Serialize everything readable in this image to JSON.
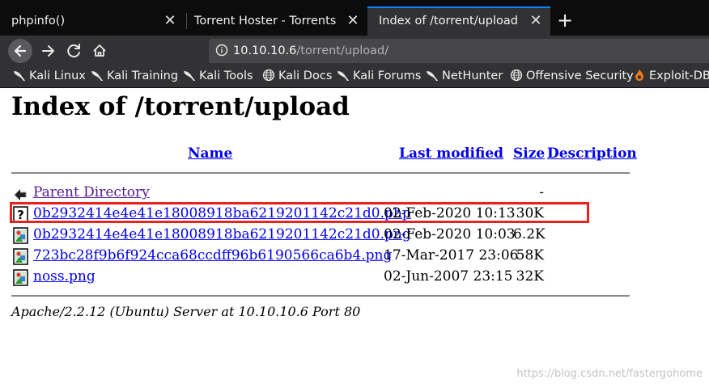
{
  "tabs": [
    {
      "title": "phpinfo()",
      "close": "✕"
    },
    {
      "title": "Torrent Hoster - Torrents",
      "close": "✕"
    },
    {
      "title": "Index of /torrent/upload",
      "close": "✕"
    }
  ],
  "new_tab": "+",
  "nav": {
    "url_host": "10.10.10.6",
    "url_path": "/torrent/upload/"
  },
  "bookmarks": [
    {
      "label": "Kali Linux",
      "icon": "kali-dragon-icon"
    },
    {
      "label": "Kali Training",
      "icon": "kali-dragon-icon"
    },
    {
      "label": "Kali Tools",
      "icon": "kali-dragon-icon"
    },
    {
      "label": "Kali Docs",
      "icon": "globe-icon"
    },
    {
      "label": "Kali Forums",
      "icon": "kali-dragon-icon"
    },
    {
      "label": "NetHunter",
      "icon": "kali-dragon-icon"
    },
    {
      "label": "Offensive Security",
      "icon": "globe-icon"
    },
    {
      "label": "Exploit-DB",
      "icon": "exploitdb-icon"
    }
  ],
  "page": {
    "title": "Index of /torrent/upload",
    "headers": {
      "name": "Name",
      "modified": "Last modified",
      "size": "Size",
      "description": "Description"
    },
    "parent": {
      "name": "Parent Directory",
      "size": "-"
    },
    "files": [
      {
        "name": "0b2932414e4e41e18008918ba6219201142c21d0.php",
        "modified": "02-Feb-2020 10:13",
        "size": "30K",
        "icon": "unknown-file-icon"
      },
      {
        "name": "0b2932414e4e41e18008918ba6219201142c21d0.png",
        "modified": "02-Feb-2020 10:03",
        "size": "6.2K",
        "icon": "image-file-icon"
      },
      {
        "name": "723bc28f9b6f924cca68ccdff96b6190566ca6b4.png",
        "modified": "17-Mar-2017 23:06",
        "size": "58K",
        "icon": "image-file-icon"
      },
      {
        "name": "noss.png",
        "modified": "02-Jun-2007 23:15",
        "size": "32K",
        "icon": "image-file-icon"
      }
    ],
    "address": "Apache/2.2.12 (Ubuntu) Server at 10.10.10.6 Port 80"
  },
  "watermark": "https://blog.csdn.net/fastergohome",
  "colors": {
    "highlight": "#e8231f",
    "tab_accent": "#0a84ff",
    "link": "#0000ee",
    "visited": "#551a8b"
  }
}
